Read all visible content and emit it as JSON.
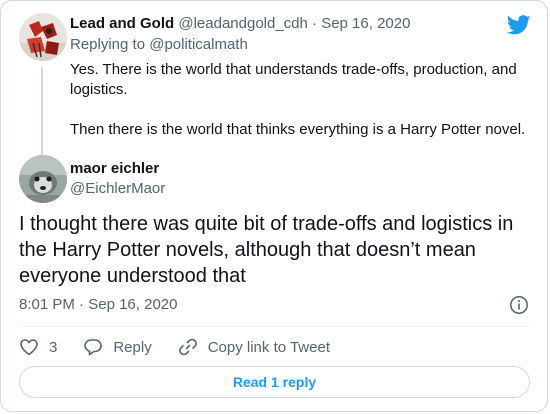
{
  "parent_tweet": {
    "author_name": "Lead and Gold",
    "author_handle": "@leadandgold_cdh",
    "separator": "·",
    "date": "Sep 16, 2020",
    "replying_to_prefix": "Replying to",
    "replying_to_handle": "@politicalmath",
    "text_line1": "Yes.  There is the world that understands trade-offs, production, and logistics.",
    "text_line2": "Then there is the world that thinks everything is a Harry Potter novel.",
    "avatar_icon": "avatar-image"
  },
  "main_tweet": {
    "author_name": "maor eichler",
    "author_handle": "@EichlerMaor",
    "text": "I thought there was quite bit of trade-offs and logistics in the Harry Potter novels, although that doesn’t mean everyone understood that",
    "time": "8:01 PM",
    "separator": "·",
    "date": "Sep 16, 2020",
    "avatar_icon": "avatar-image"
  },
  "actions": {
    "like_count": "3",
    "reply_label": "Reply",
    "copy_link_label": "Copy link to Tweet"
  },
  "read_replies_label": "Read 1 reply",
  "icons": {
    "brand": "twitter-bird-icon",
    "info": "info-icon",
    "like": "heart-icon",
    "reply": "reply-bubble-icon",
    "link": "link-icon"
  },
  "colors": {
    "brand_blue": "#1d9bf0",
    "muted_text": "#536471",
    "border": "#cfd9de"
  }
}
